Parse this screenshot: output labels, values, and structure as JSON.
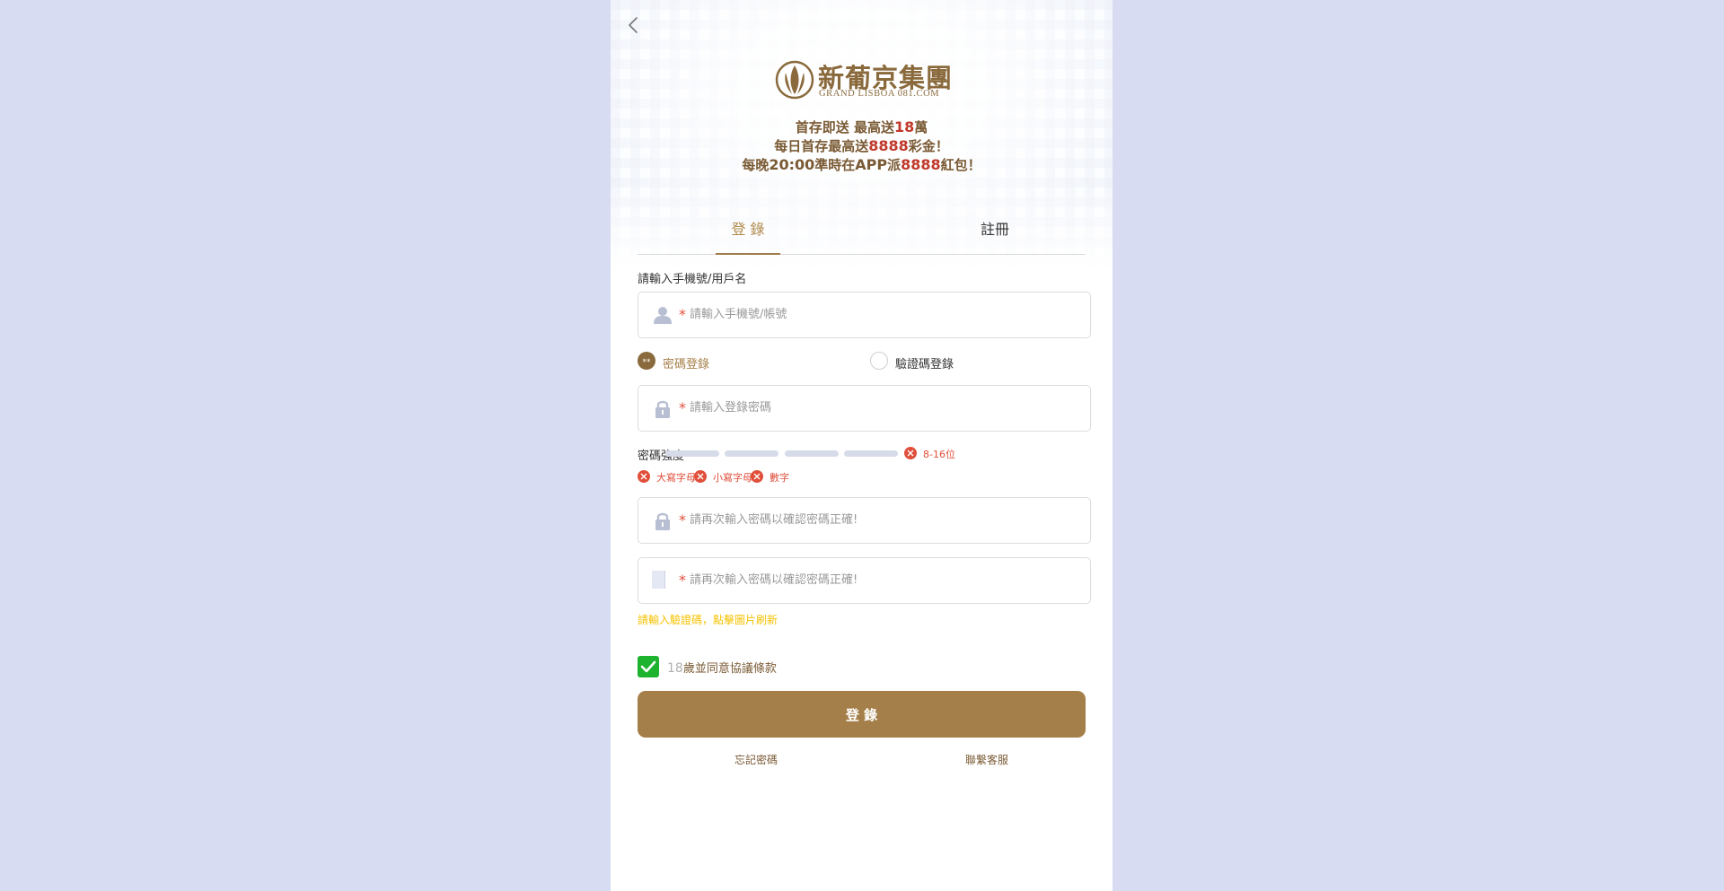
{
  "brand": {
    "name_cn": "新葡京集團",
    "name_en": "GRAND LISBOA  081.COM"
  },
  "promo": {
    "line1": {
      "prefix": "首存即送 最高送",
      "highlight": "18",
      "suffix": "萬"
    },
    "line2": {
      "prefix": "每日首存最高送",
      "highlight": "8888",
      "suffix": "彩金！"
    },
    "line3": {
      "prefix": "每晚",
      "highlight_dark": "20:00",
      "mid": "準時在",
      "highlight_dark2": "APP",
      "mid2": "派",
      "highlight": "8888",
      "suffix": "紅包！"
    }
  },
  "tabs": [
    {
      "label": "登 錄",
      "active": true
    },
    {
      "label": "註冊",
      "active": false
    }
  ],
  "form": {
    "account_label": "請輸入手機號/用戶名",
    "account_placeholder": "請輸入手機號/帳號",
    "radios": [
      {
        "label": "密碼登錄",
        "selected": true
      },
      {
        "label": "驗證碼登錄",
        "selected": false
      }
    ],
    "password_placeholder": "請輸入登錄密碼",
    "strength_label": "密碼強度",
    "strength_level": 0,
    "length_rule": "8-16位",
    "rules": [
      "大寫字母",
      "小寫字母",
      "數字"
    ],
    "confirm_placeholder": "請再次輸入密碼以確認密碼正確!",
    "captcha_placeholder": "請再次輸入密碼以確認密碼正確!",
    "hint": "請輸入驗證碼，點擊圖片刷新",
    "agree_num": "18",
    "agree_text": "歲並同意協議條款",
    "agree_checked": true,
    "submit_label": "登 錄",
    "link_left": "忘記密碼",
    "link_right": "聯繫客服"
  },
  "colors": {
    "page_bg": "#d7dcf2",
    "brand_gold": "#a57f49",
    "accent_red": "#e04f3b",
    "check_green": "#1db32e",
    "hint_yellow": "#f5c200"
  },
  "icons": [
    "back-chevron-icon",
    "brand-logo-icon",
    "user-icon",
    "lock-icon",
    "captcha-image",
    "close-circle-icon",
    "check-icon"
  ]
}
